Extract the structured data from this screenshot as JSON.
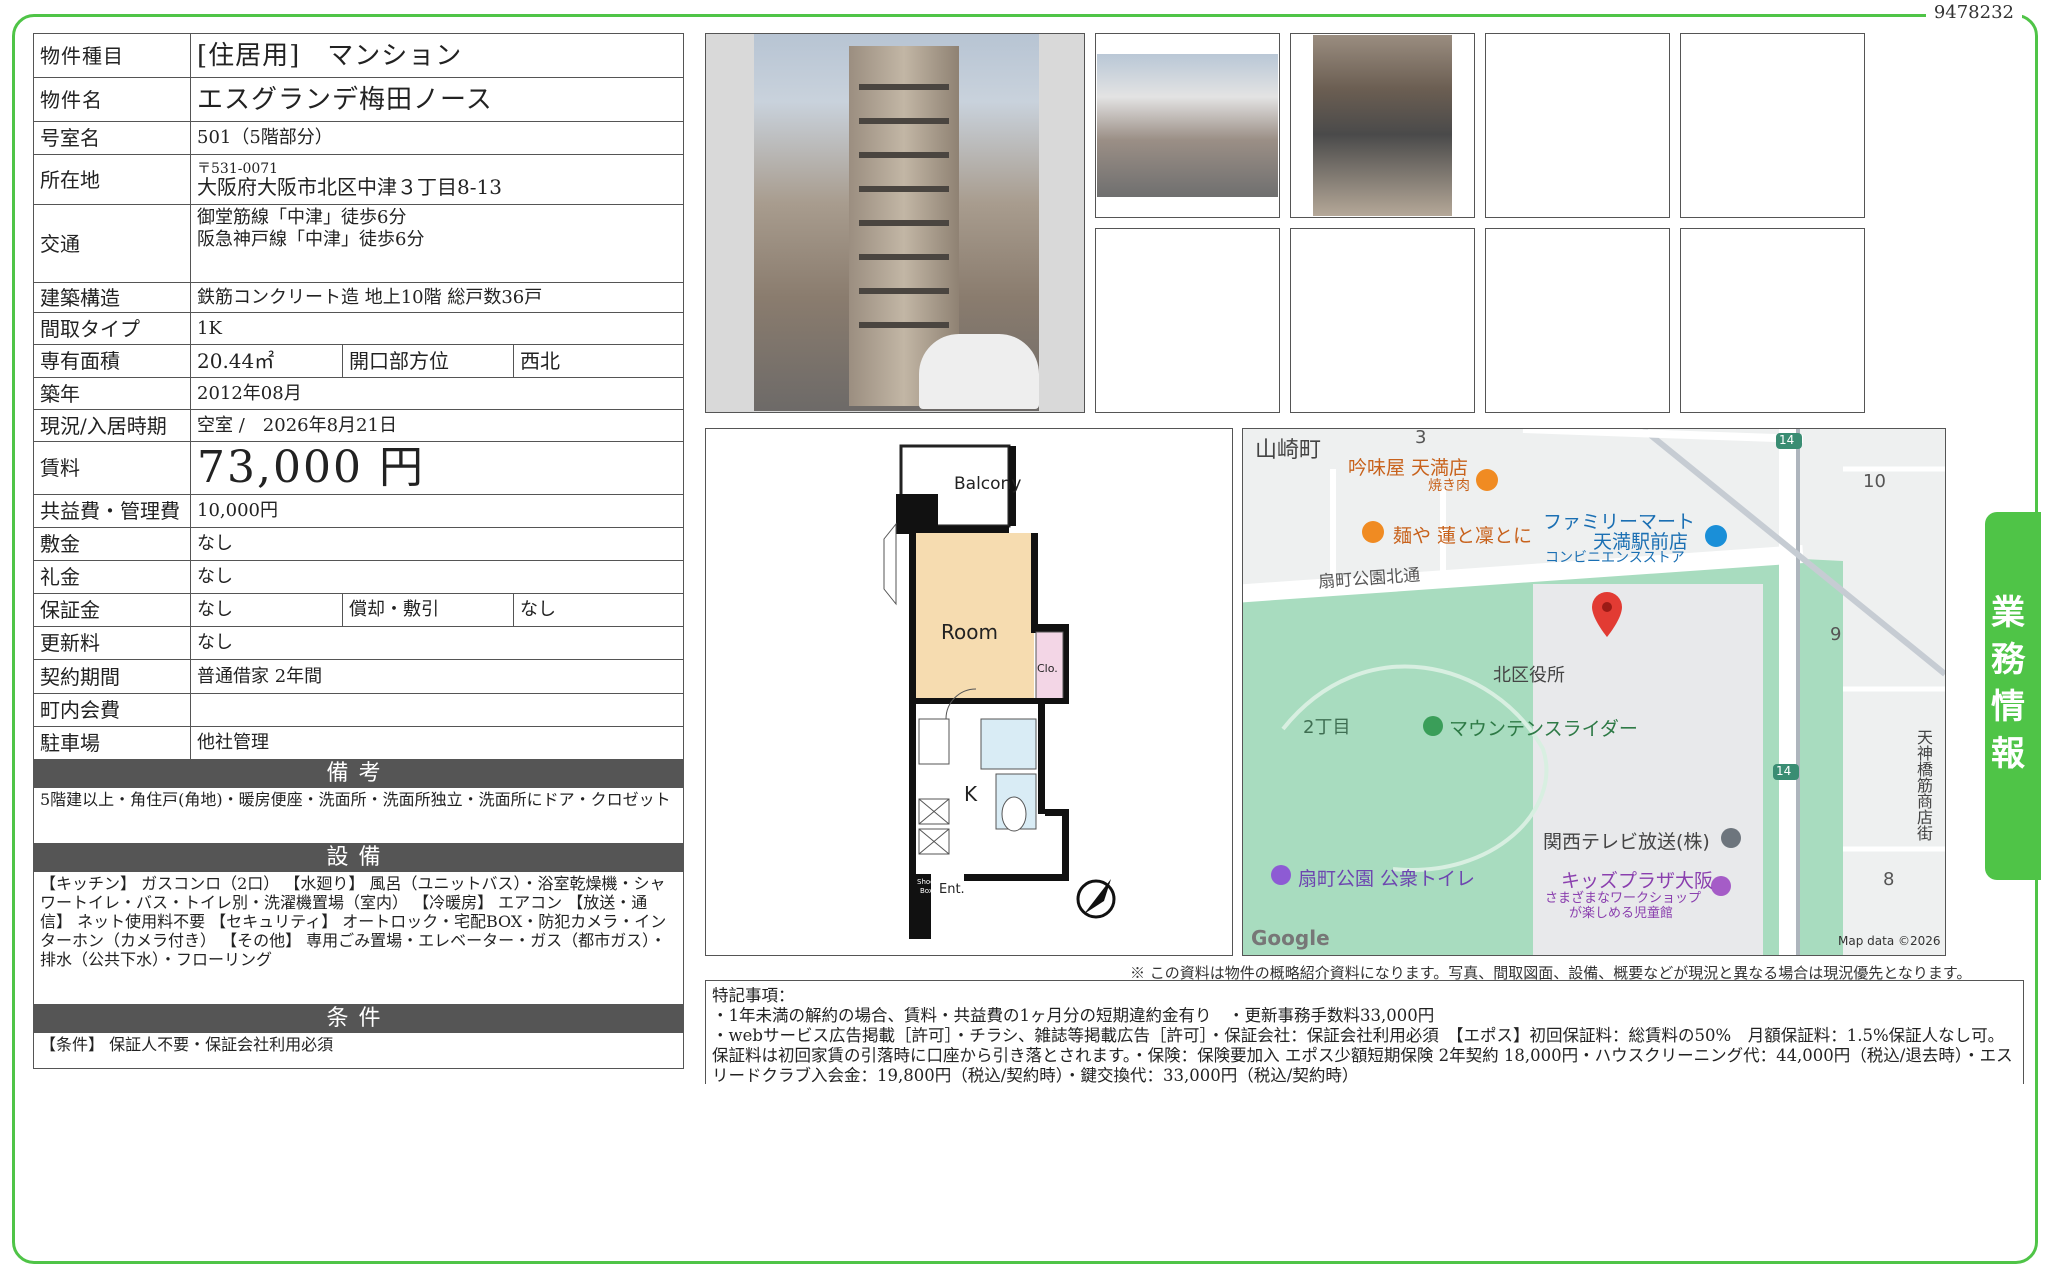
{
  "doc_id": "9478232",
  "property": {
    "type_label": "物件種目",
    "type_value": "[住居用]　マンション",
    "name_label": "物件名",
    "name_value": "エスグランデ梅田ノース",
    "room_label": "号室名",
    "room_value": "501（5階部分）",
    "address_label": "所在地",
    "postal": "〒531-0071",
    "address_value": "大阪府大阪市北区中津３丁目8-13",
    "transport_label": "交通",
    "transport_1": "御堂筋線「中津」徒歩6分",
    "transport_2": "阪急神戸線「中津」徒歩6分",
    "structure_label": "建築構造",
    "structure_value": "鉄筋コンクリート造 地上10階 総戸数36戸",
    "layout_label": "間取タイプ",
    "layout_value": "1K",
    "area_label": "専有面積",
    "area_value": "20.44㎡",
    "direction_label": "開口部方位",
    "direction_value": "西北",
    "built_label": "築年",
    "built_value": "2012年08月",
    "status_label": "現況/入居時期",
    "status_value": "空室 /　2026年8月21日",
    "rent_label": "賃料",
    "rent_value": "73,000 円",
    "fee_label": "共益費・管理費",
    "fee_value": "10,000円",
    "deposit_label": "敷金",
    "deposit_value": "なし",
    "key_money_label": "礼金",
    "key_money_value": "なし",
    "guarantee_label": "保証金",
    "guarantee_value": "なし",
    "amortization_label": "償却・敷引",
    "amortization_value": "なし",
    "renewal_label": "更新料",
    "renewal_value": "なし",
    "contract_label": "契約期間",
    "contract_value": "普通借家 2年間",
    "community_label": "町内会費",
    "community_value": "",
    "parking_label": "駐車場",
    "parking_value": "他社管理"
  },
  "sections": {
    "remarks_title": "備考",
    "remarks_text": "5階建以上・角住戸(角地)・暖房便座・洗面所・洗面所独立・洗面所にドア・クロゼット",
    "equipment_title": "設備",
    "equipment_text": "【キッチン】 ガスコンロ（2口） 【水廻り】 風呂（ユニットバス）・浴室乾燥機・シャワートイレ・バス・トイレ別・洗濯機置場（室内） 【冷暖房】 エアコン 【放送・通信】 ネット使用料不要 【セキュリティ】 オートロック・宅配BOX・防犯カメラ・インターホン（カメラ付き） 【その他】 専用ごみ置場・エレベーター・ガス（都市ガス）・排水（公共下水）・フローリング",
    "conditions_title": "条件",
    "conditions_text": "【条件】 保証人不要・保証会社利用必須"
  },
  "floorplan": {
    "balcony": "Balcony",
    "room": "Room",
    "closet": "Clo.",
    "kitchen": "K",
    "shoes_1": "Shoes",
    "shoes_2": "Box",
    "entrance": "Ent."
  },
  "map": {
    "yamazaki": "山崎町",
    "n3": "3",
    "n10": "10",
    "n9": "9",
    "n8": "8",
    "n14a": "14",
    "n14b": "14",
    "ginmiya": "吟味屋 天満店",
    "yakiniku": "焼き肉",
    "menya": "麺や 蓮と凜とに",
    "familymart": "ファミリーマート",
    "familymart_2": "天満駅前店",
    "convenience": "コンビニエンスストア",
    "ogimachi_street": "扇町公園北通",
    "kitaku": "北区役所",
    "chome2": "2丁目",
    "mountain": "マウンテンスライダー",
    "kantele": "関西テレビ放送(株)",
    "toilet": "扇町公園 公衆トイレ",
    "kids": "キッズプラザ大阪",
    "kids_2": "さまざまなワークショップ",
    "kids_3": "が楽しめる児童館",
    "tenjin": "天神橋筋商店街",
    "google": "Google",
    "mapdata": "Map data ©2026"
  },
  "disclaimer": "※ この資料は物件の概略紹介資料になります。写真、間取図面、設備、概要などが現況と異なる場合は現況優先となります。",
  "special": {
    "title": "特記事項：",
    "line1": "・1年未満の解約の場合、賃料・共益費の1ヶ月分の短期違約金有り　・更新事務手数料33,000円",
    "line2": "・webサービス広告掲載［許可］・チラシ、雑誌等掲載広告［許可］・保証会社：保証会社利用必須　【エポス】初回保証料：総賃料の50%　月額保証料：1.5%保証人なし可。保証料は初回家賃の引落時に口座から引き落とされます。・保険：保険要加入 エポス少額短期保険 2年契約 18,000円・ハウスクリーニング代：44,000円（税込/退去時）・エスリードクラブ入会金：19,800円（税込/契約時）・鍵交換代：33,000円（税込/契約時）"
  },
  "side_tab": "業務情報",
  "colors": {
    "frame_green": "#4fc447",
    "section_gray": "#555555"
  }
}
